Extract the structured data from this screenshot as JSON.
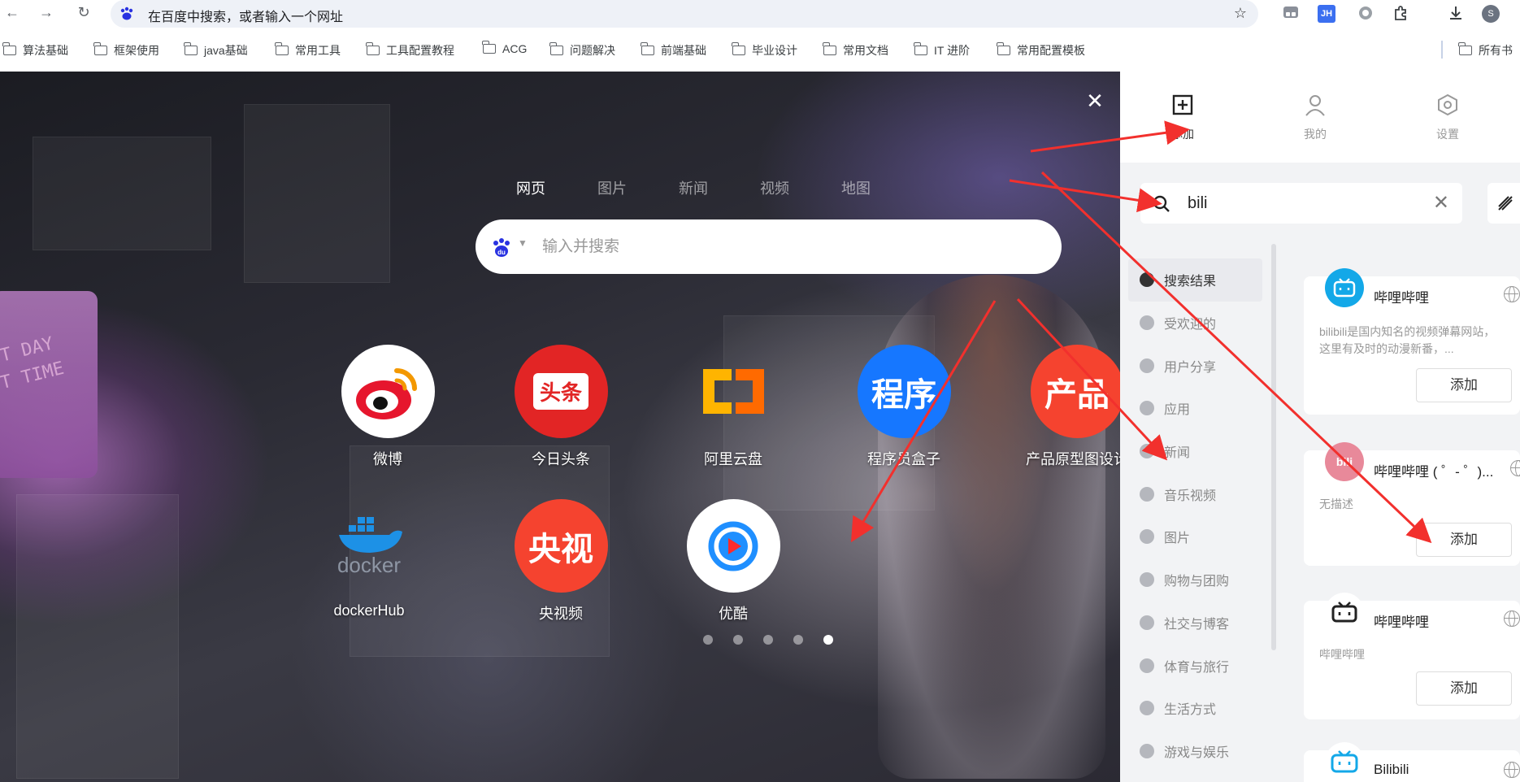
{
  "browser": {
    "address_text": "在百度中搜索，或者输入一个网址",
    "profile_initial": "S",
    "ext_jh": "JH"
  },
  "bookmarks": [
    "算法基础",
    "框架使用",
    "java基础",
    "常用工具",
    "工具配置教程",
    "ACG",
    "问题解决",
    "前端基础",
    "毕业设计",
    "常用文档",
    "IT 进阶",
    "常用配置模板"
  ],
  "bookmarks_all": "所有书",
  "newtab": {
    "search_tabs": [
      "网页",
      "图片",
      "新闻",
      "视频",
      "地图"
    ],
    "active_tab": "网页",
    "search_placeholder": "输入并搜索",
    "apps": [
      {
        "label": "微博",
        "icon": "weibo-icon"
      },
      {
        "label": "今日头条",
        "icon": "toutiao-icon",
        "text": "头条"
      },
      {
        "label": "阿里云盘",
        "icon": "aliyun-drive-icon"
      },
      {
        "label": "程序员盒子",
        "icon": "programmer-box-icon",
        "text": "程序"
      },
      {
        "label": "产品原型图设计",
        "icon": "product-icon",
        "text": "产品"
      },
      {
        "label": "dockerHub",
        "icon": "docker-icon",
        "text": "docker"
      },
      {
        "label": "央视频",
        "icon": "cctv-icon",
        "text": "央视"
      },
      {
        "label": "优酷",
        "icon": "youku-icon"
      }
    ],
    "pages": 5,
    "active_page": 5
  },
  "panel": {
    "tabs": [
      {
        "label": "添加",
        "icon": "add-square-icon"
      },
      {
        "label": "我的",
        "icon": "user-icon"
      },
      {
        "label": "设置",
        "icon": "settings-hexagon-icon"
      }
    ],
    "search_value": "bili",
    "categories": [
      "搜索结果",
      "受欢迎的",
      "用户分享",
      "应用",
      "新闻",
      "音乐视频",
      "图片",
      "购物与团购",
      "社交与博客",
      "体育与旅行",
      "生活方式",
      "游戏与娱乐"
    ],
    "active_category": "搜索结果",
    "results": [
      {
        "name": "哔哩哔哩",
        "desc": "bilibili是国内知名的视频弹幕网站，这里有及时的动漫新番，...",
        "add": "添加",
        "logo_color": "#13a8e8"
      },
      {
        "name": "哔哩哔哩 ( ゜- ゜)...",
        "desc": "无描述",
        "add": "添加",
        "logo_color": "#e8899a"
      },
      {
        "name": "哔哩哔哩",
        "desc": "哔哩哔哩",
        "add": "添加",
        "logo_color": "#222222"
      },
      {
        "name": "Bilibili",
        "desc": "",
        "add": "",
        "logo_color": "#13a8e8"
      }
    ]
  },
  "colors": {
    "annotation_red": "#f2302d",
    "weibo": "#e6162d",
    "toutiao": "#e22525",
    "aliyun": "#ff8a00",
    "programmer": "#1677ff",
    "product": "#f5432f",
    "cctv": "#f5432f",
    "youku": "#1f8fff"
  }
}
